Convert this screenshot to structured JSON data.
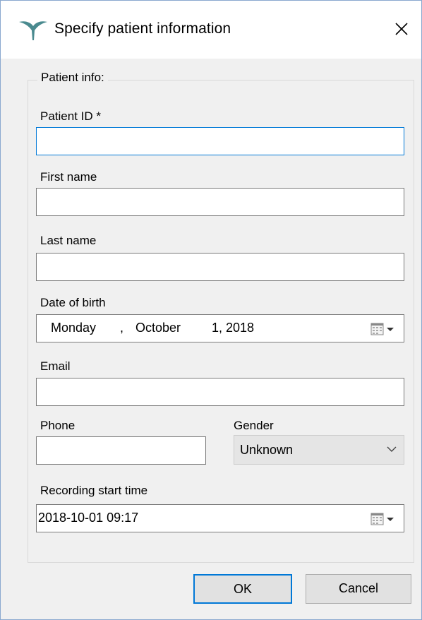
{
  "window": {
    "title": "Specify patient information",
    "close_glyph": "✕"
  },
  "group": {
    "legend": "Patient info:"
  },
  "fields": {
    "patient_id": {
      "label": "Patient ID *",
      "value": ""
    },
    "first_name": {
      "label": "First name",
      "value": ""
    },
    "last_name": {
      "label": "Last name",
      "value": ""
    },
    "date_of_birth": {
      "label": "Date of birth",
      "weekday": "Monday",
      "sep": ",",
      "month": "October",
      "day_year": "1, 2018"
    },
    "email": {
      "label": "Email",
      "value": ""
    },
    "phone": {
      "label": "Phone",
      "value": ""
    },
    "gender": {
      "label": "Gender",
      "value": "Unknown"
    },
    "recording_start": {
      "label": "Recording start time",
      "value": "2018-10-01 09:17"
    }
  },
  "buttons": {
    "ok": "OK",
    "cancel": "Cancel"
  },
  "icons": {
    "app": "y-shaped-logo-icon",
    "calendar": "calendar-dropdown-icon",
    "combo_arrow": "chevron-down-icon"
  },
  "colors": {
    "focus_border": "#0078d7",
    "logo": "#4a8a8f"
  }
}
